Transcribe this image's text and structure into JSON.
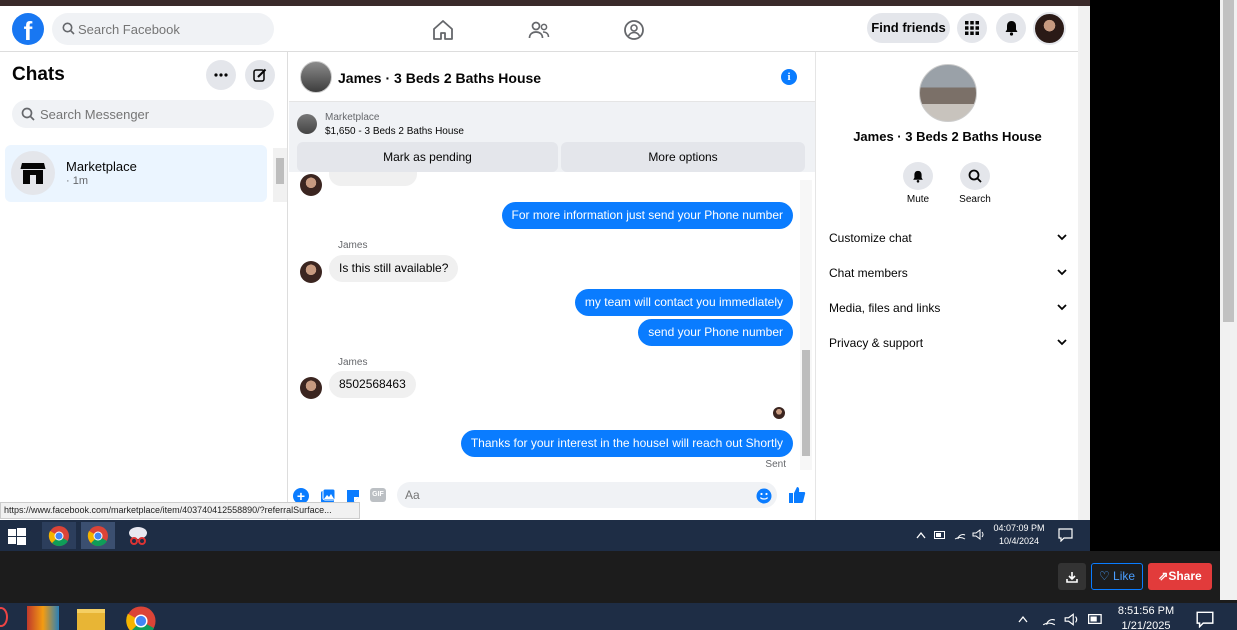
{
  "fb": {
    "search_placeholder": "Search Facebook",
    "find_friends": "Find friends"
  },
  "chats": {
    "title": "Chats",
    "search_placeholder": "Search Messenger",
    "items": [
      {
        "name": "Marketplace",
        "time": "· 1m"
      }
    ]
  },
  "conversation": {
    "title": "James · 3 Beds 2 Baths House",
    "listing_category": "Marketplace",
    "listing_price": "$1,650 - 3 Beds 2 Baths House",
    "mark_pending": "Mark as pending",
    "more_options": "More options",
    "messages": [
      {
        "text": "For more information just send your Phone number",
        "dir": "out"
      },
      {
        "sender": "James",
        "text": "Is this still available?",
        "dir": "in"
      },
      {
        "text": "my team will contact you immediately",
        "dir": "out"
      },
      {
        "text": "send your Phone number",
        "dir": "out"
      },
      {
        "sender": "James",
        "text": "8502568463",
        "dir": "in"
      },
      {
        "text": "Thanks for your interest in the houseI will reach out Shortly",
        "dir": "out"
      }
    ],
    "sent_label": "Sent",
    "composer_placeholder": "Aa"
  },
  "panel": {
    "name": "James · 3 Beds 2 Baths House",
    "mute": "Mute",
    "search": "Search",
    "rows": [
      "Customize chat",
      "Chat members",
      "Media, files and links",
      "Privacy & support"
    ]
  },
  "status_url": "https://www.facebook.com/marketplace/item/403740412558890/?referralSurface...",
  "inner_clock": {
    "time": "04:07:09 PM",
    "date": "10/4/2024"
  },
  "outer": {
    "like": "Like",
    "share": "Share",
    "time": "8:51:56 PM",
    "date": "1/21/2025"
  },
  "colors": {
    "accent": "#0a7cff",
    "fb_blue": "#1877f2",
    "share_red": "#e23b3b"
  }
}
